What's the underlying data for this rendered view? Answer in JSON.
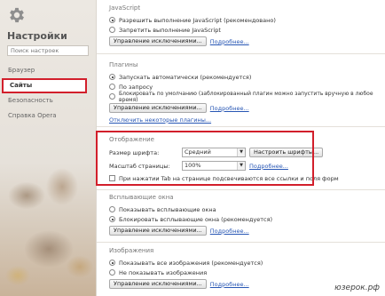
{
  "sidebar": {
    "title": "Настройки",
    "search_placeholder": "Поиск настроек",
    "items": [
      {
        "label": "Браузер"
      },
      {
        "label": "Сайты"
      },
      {
        "label": "Безопасность"
      },
      {
        "label": "Справка Opera"
      }
    ]
  },
  "javascript": {
    "title": "JavaScript",
    "options": [
      "Разрешить выполнение JavaScript (рекомендовано)",
      "Запретить выполнение JavaScript"
    ],
    "exceptions_button": "Управление исключениями...",
    "more_link": "Подробнее..."
  },
  "plugins": {
    "title": "Плагины",
    "options": [
      "Запускать автоматически (рекомендуется)",
      "По запросу",
      "Блокировать по умолчанию (заблокированный плагин можно запустить вручную в любое время)"
    ],
    "exceptions_button": "Управление исключениями...",
    "more_link": "Подробнее...",
    "disable_link": "Отключить некоторые плагины..."
  },
  "display": {
    "title": "Отображение",
    "font_size_label": "Размер шрифта:",
    "font_size_value": "Средний",
    "fonts_button": "Настроить шрифты...",
    "zoom_label": "Масштаб страницы:",
    "zoom_value": "100%",
    "more_link": "Подробнее...",
    "tab_highlight_label": "При нажатии Tab на странице подсвечиваются все ссылки и поля форм"
  },
  "popups": {
    "title": "Всплывающие окна",
    "options": [
      "Показывать всплывающие окна",
      "Блокировать всплывающие окна (рекомендуется)"
    ],
    "exceptions_button": "Управление исключениями...",
    "more_link": "Подробнее..."
  },
  "images": {
    "title": "Изображения",
    "options": [
      "Показывать все изображения (рекомендуется)",
      "Не показывать изображения"
    ],
    "exceptions_button": "Управление исключениями...",
    "more_link": "Подробнее..."
  },
  "watermark": "юзерок.рф",
  "colors": {
    "highlight": "#d21f2b",
    "link": "#2756b4"
  }
}
